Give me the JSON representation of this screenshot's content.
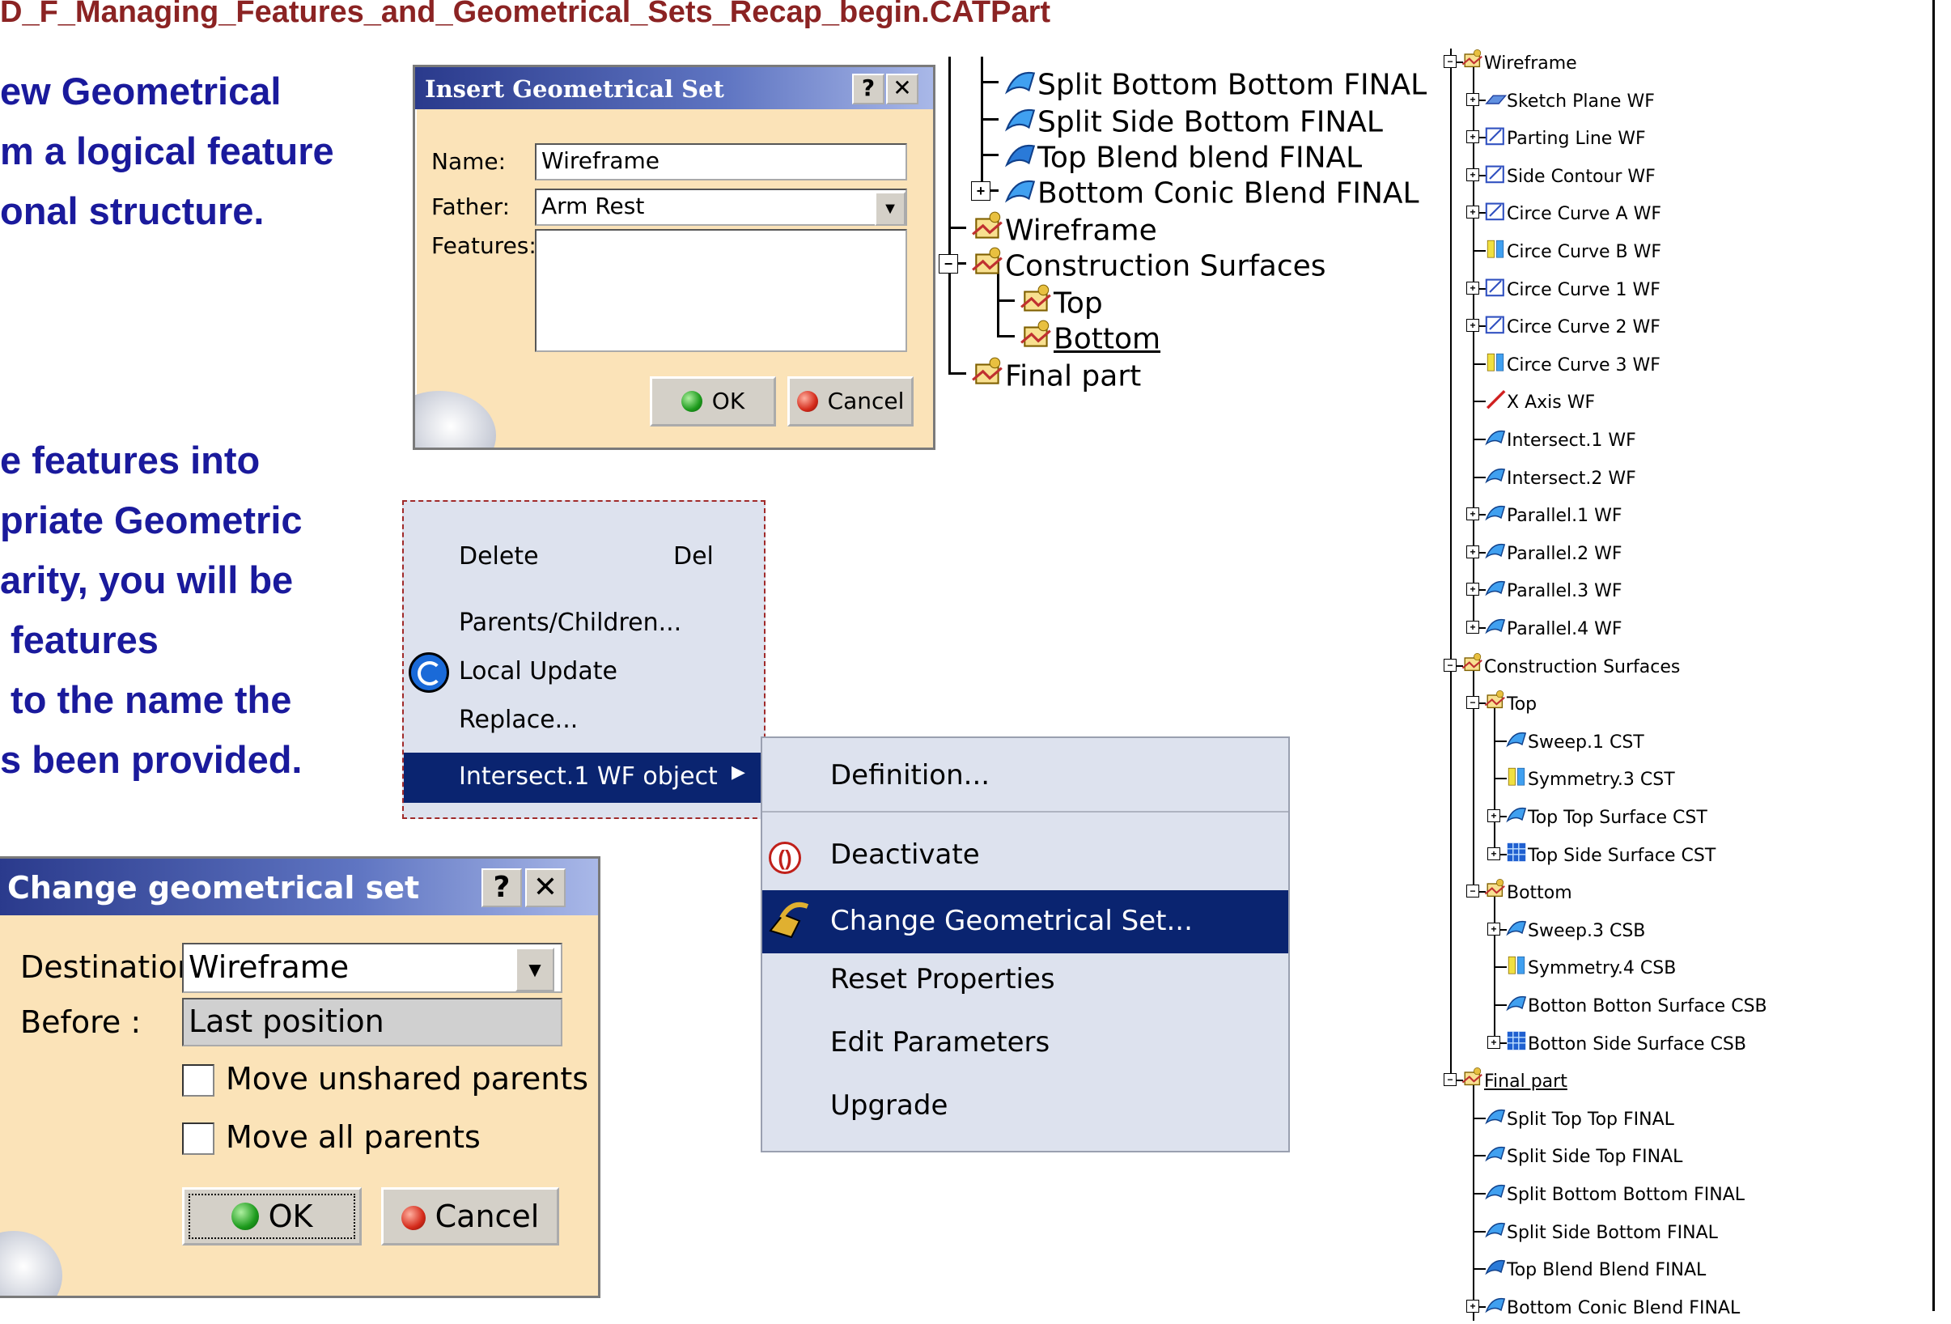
{
  "slide": {
    "title": "D_F_Managing_Features_and_Geometrical_Sets_Recap_begin.CATPart",
    "para1": [
      "ew Geometrical",
      "m a logical feature",
      "onal structure."
    ],
    "para2": [
      "e features into",
      "priate Geometric",
      "arity, you will be",
      " features",
      " to the name the",
      "s been provided."
    ]
  },
  "insert_dialog": {
    "title": "Insert Geometrical Set",
    "help": "?",
    "close": "✕",
    "name_label": "Name:",
    "name_value": "Wireframe",
    "father_label": "Father:",
    "father_value": "Arm Rest",
    "features_label": "Features:",
    "ok": "OK",
    "cancel": "Cancel"
  },
  "context_menu": {
    "delete": "Delete",
    "delete_shortcut": "Del",
    "parents_children": "Parents/Children...",
    "local_update": "Local Update",
    "replace": "Replace...",
    "object": "Intersect.1 WF object"
  },
  "submenu": {
    "definition": "Definition...",
    "deactivate": "Deactivate",
    "change_set": "Change Geometrical Set...",
    "reset": "Reset Properties",
    "edit_params": "Edit Parameters",
    "upgrade": "Upgrade"
  },
  "change_dialog": {
    "title": "Change geometrical set",
    "help": "?",
    "close": "✕",
    "destination_label": "Destination:",
    "destination_value": "Wireframe",
    "before_label": "Before :",
    "before_value": "Last position",
    "move_unshared": "Move unshared parents",
    "move_all": "Move all parents",
    "ok": "OK",
    "cancel": "Cancel"
  },
  "mid_tree": {
    "items": [
      "Split Bottom Bottom FINAL",
      "Split Side Bottom FINAL",
      "Top Blend blend FINAL",
      "Bottom Conic Blend FINAL",
      "Wireframe",
      "Construction Surfaces",
      "Top",
      "Bottom",
      "Final part"
    ]
  },
  "right_tree": {
    "items": [
      "Wireframe",
      "Sketch Plane WF",
      "Parting Line WF",
      "Side Contour WF",
      "Circe Curve A WF",
      "Circe Curve B WF",
      "Circe Curve 1 WF",
      "Circe Curve 2 WF",
      "Circe Curve 3 WF",
      "X Axis WF",
      "Intersect.1 WF",
      "Intersect.2 WF",
      "Parallel.1 WF",
      "Parallel.2 WF",
      "Parallel.3 WF",
      "Parallel.4 WF",
      "Construction Surfaces",
      "Top",
      "Sweep.1 CST",
      "Symmetry.3 CST",
      "Top Top Surface CST",
      "Top Side Surface CST",
      "Bottom",
      "Sweep.3 CSB",
      "Symmetry.4 CSB",
      "Botton Botton Surface CSB",
      "Botton Side Surface CSB",
      "Final part",
      "Split Top Top FINAL",
      "Split Side Top FINAL",
      "Split Bottom Bottom FINAL",
      "Split Side Bottom FINAL",
      "Top Blend Blend FINAL",
      "Bottom Conic Blend FINAL"
    ]
  },
  "colors": {
    "title": "#8b2323",
    "body_text": "#1a1a9c",
    "dialog_bg": "#fbe3b8",
    "menu_highlight": "#0a2470",
    "menu_bg": "#dde2ee"
  }
}
